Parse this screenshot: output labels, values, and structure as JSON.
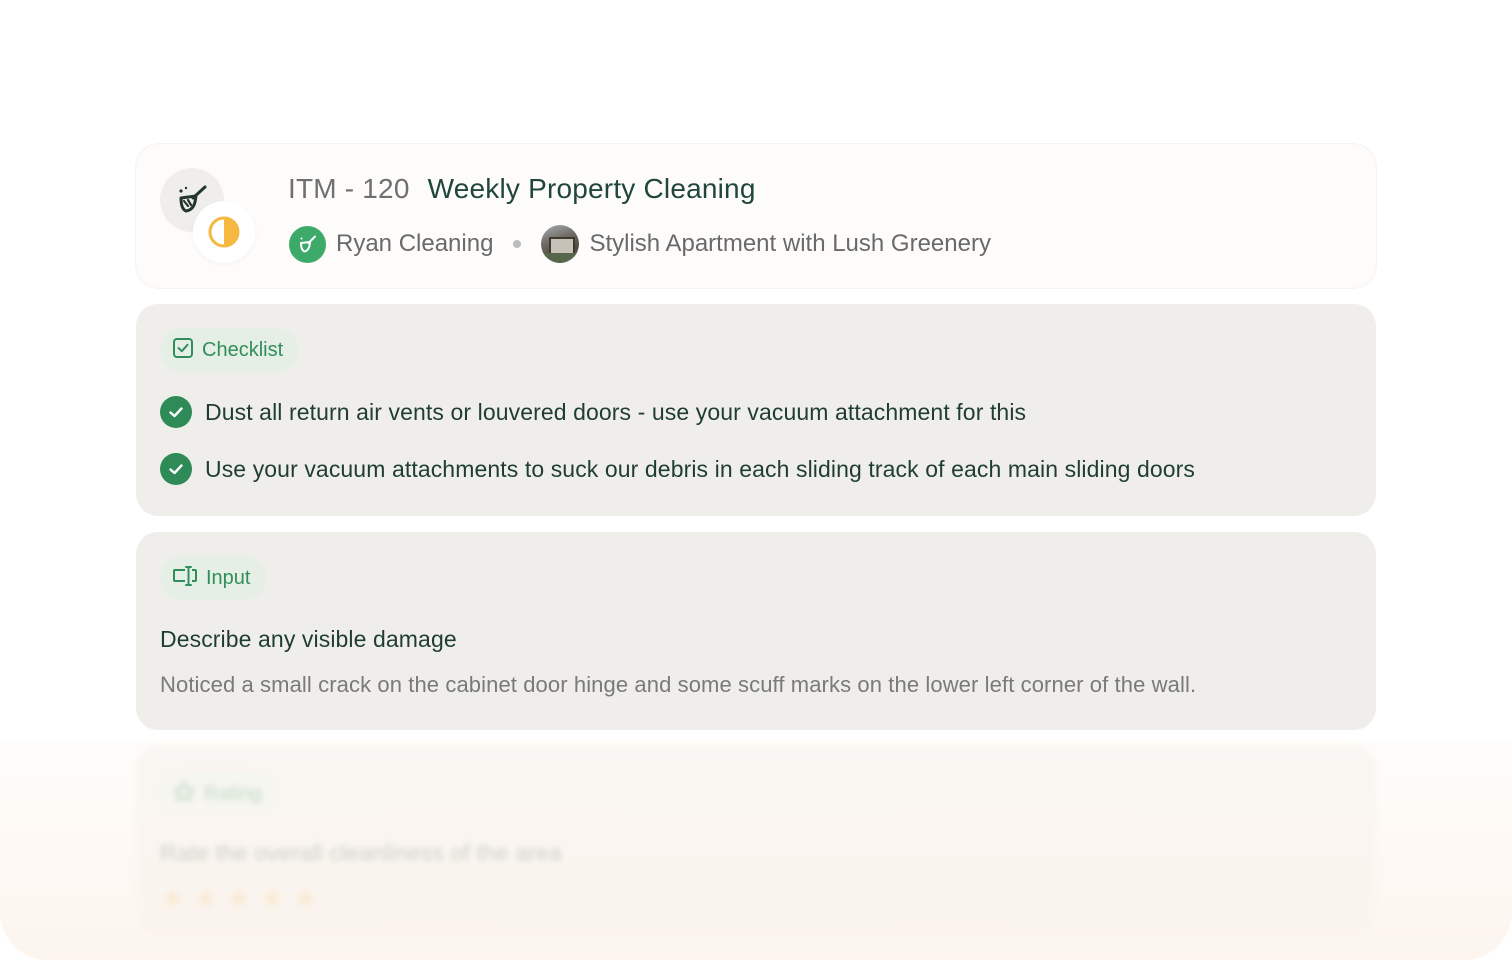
{
  "header": {
    "item_id": "ITM - 120",
    "title": "Weekly Property Cleaning",
    "vendor": "Ryan Cleaning",
    "property": "Stylish Apartment with Lush Greenery",
    "task_icon": "cleaning-broom-icon",
    "status_icon": "half-circle-status-icon",
    "status_color": "#f5b941"
  },
  "checklist": {
    "label": "Checklist",
    "icon": "checkbox-icon",
    "items": [
      {
        "text": "Dust all return air vents or louvered doors - use your vacuum attachment for this",
        "checked": true
      },
      {
        "text": "Use your vacuum attachments to suck our debris in each sliding track of each main sliding doors",
        "checked": true
      }
    ]
  },
  "input": {
    "label": "Input",
    "icon": "text-input-icon",
    "question": "Describe any visible damage",
    "answer": "Noticed a small crack on the cabinet door hinge and some scuff marks on the lower left corner of the wall."
  },
  "rating": {
    "label": "Rating",
    "icon": "star-outline-icon",
    "question": "Rate the overall cleanliness of the area",
    "value": 5,
    "max": 5
  },
  "colors": {
    "accent": "#2e8a57",
    "title": "#21473a",
    "card_bg": "#efeeea",
    "star": "#f1a944"
  }
}
